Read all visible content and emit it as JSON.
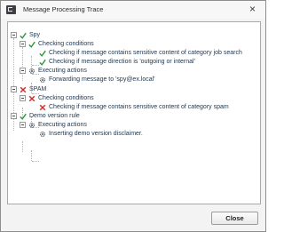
{
  "window": {
    "title": "Message Processing Trace",
    "close_glyph": "×"
  },
  "tree": {
    "spy": {
      "label": "Spy",
      "conditions": {
        "label": "Checking conditions",
        "items": [
          "Checking if message contains sensitive content of category job search",
          "Checking if message direction is 'outgoing or internal'"
        ]
      },
      "actions": {
        "label": "Executing actions",
        "items": [
          "Forwarding message to 'spy@ex.local'"
        ]
      }
    },
    "spam": {
      "label": "SPAM",
      "conditions": {
        "label": "Checking conditions",
        "items": [
          "Checking if message contains sensitive content of category spam"
        ]
      }
    },
    "demo": {
      "label": "Demo version rule",
      "actions": {
        "label": "Executing actions",
        "items": [
          "Inserting demo version disclaimer."
        ]
      }
    }
  },
  "icons": {
    "check": "check-icon",
    "cross": "cross-icon",
    "gear": "gear-icon",
    "app": "app-icon"
  },
  "colors": {
    "check": "#2e9a3f",
    "cross": "#d02a2a",
    "gear": "#505a66",
    "text": "#1e3550"
  },
  "footer": {
    "close_label": "Close"
  }
}
